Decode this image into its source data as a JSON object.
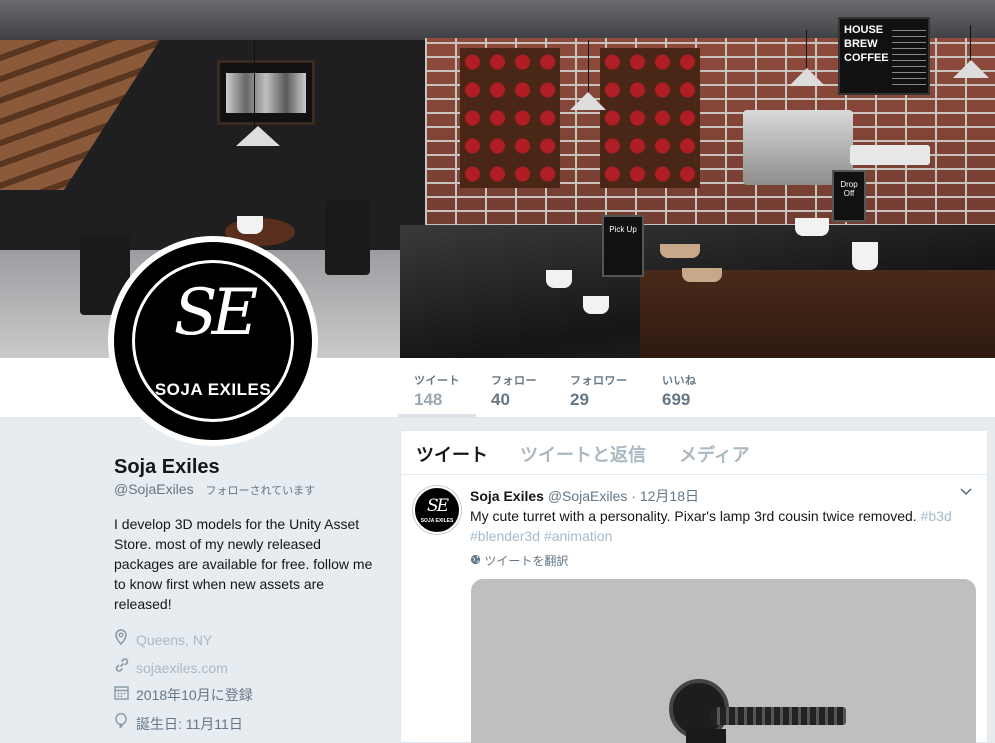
{
  "profile": {
    "name": "Soja Exiles",
    "handle": "@SojaExiles",
    "follows_you": "フォローされています",
    "bio": "I develop 3D models for the Unity Asset Store. most of my newly released packages are available for free. follow me to know first when new assets are released!",
    "location": "Queens, NY",
    "website": "sojaexiles.com",
    "joined": "2018年10月に登録",
    "birthday": "誕生日: 11月11日",
    "avatar_monogram": "SE",
    "avatar_brand": "SOJA EXILES"
  },
  "banner": {
    "sign_text": "HOUSE BREW COFFEE",
    "pickup_sign": "Pick Up",
    "dropoff_sign": "Drop Off"
  },
  "stats": [
    {
      "label": "ツイート",
      "value": "148"
    },
    {
      "label": "フォロー",
      "value": "40"
    },
    {
      "label": "フォロワー",
      "value": "29"
    },
    {
      "label": "いいね",
      "value": "699"
    }
  ],
  "tabs": [
    "ツイート",
    "ツイートと返信",
    "メディア"
  ],
  "tweet": {
    "name": "Soja Exiles",
    "handle": "@SojaExiles",
    "dot": "·",
    "date": "12月18日",
    "text": "My cute turret with a personality.  Pixar's lamp 3rd cousin twice removed.",
    "hashtags": [
      "#b3d",
      "#blender3d",
      "#animation"
    ],
    "translate": "ツイートを翻訳",
    "avatar_brand": "SOJA EXILES"
  },
  "icons": {
    "location": "location-pin-icon",
    "link": "link-icon",
    "calendar": "calendar-icon",
    "balloon": "balloon-icon",
    "globe": "globe-icon",
    "caret": "chevron-down-icon"
  },
  "colors": {
    "page_bg": "#e6ecf0",
    "text_primary": "#14171a",
    "text_secondary": "#657786",
    "link": "#a8bac8"
  }
}
